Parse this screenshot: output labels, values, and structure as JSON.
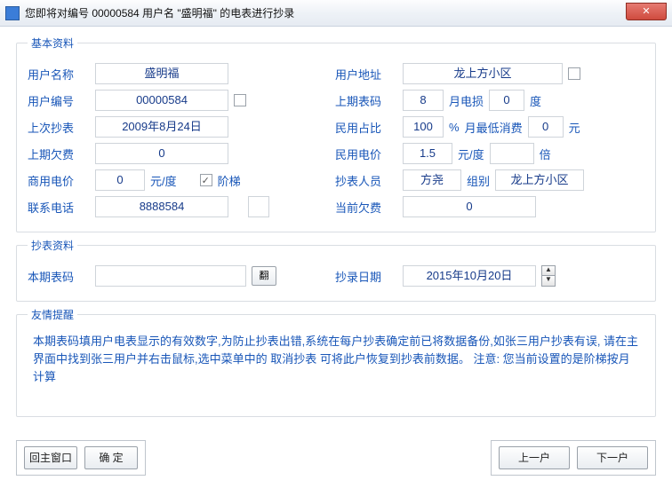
{
  "window": {
    "title": "您即将对编号 00000584 用户名 \"盛明福\" 的电表进行抄录",
    "close": "✕"
  },
  "groups": {
    "basic": "基本资料",
    "reading": "抄表资料",
    "reminder": "友情提醒"
  },
  "basic": {
    "userNameLabel": "用户名称",
    "userName": "盛明福",
    "userAddrLabel": "用户地址",
    "userAddr": "龙上方小区",
    "userNoLabel": "用户编号",
    "userNo": "00000584",
    "prevCodeLabel": "上期表码",
    "prevCode": "8",
    "monthLossLabel": "月电损",
    "monthLoss": "0",
    "unitDu": "度",
    "lastReadLabel": "上次抄表",
    "lastRead": "2009年8月24日",
    "resRatioLabel": "民用占比",
    "resRatio": "100",
    "pct": "%",
    "minConsLabel": "月最低消费",
    "minCons": "0",
    "unitYuan": "元",
    "prevOweLabel": "上期欠费",
    "prevOwe": "0",
    "resPriceLabel": "民用电价",
    "resPrice": "1.5",
    "yuanPerDu": "元/度",
    "timesLabel": "倍",
    "comPriceLabel": "商用电价",
    "comPrice": "0",
    "ladderLabel": "阶梯",
    "readerLabel": "抄表人员",
    "reader": "方尧",
    "groupLabel": "组别",
    "group": "龙上方小区",
    "phoneLabel": "联系电话",
    "phone": "8888584",
    "curOweLabel": "当前欠费",
    "curOwe": "0"
  },
  "reading": {
    "curCodeLabel": "本期表码",
    "curCode": "",
    "flipBtn": "翻",
    "readDateLabel": "抄录日期",
    "readDate": "2015年10月20日"
  },
  "reminder": {
    "text": "本期表码填用户电表显示的有效数字,为防止抄表出错,系统在每户抄表确定前已将数据备份,如张三用户抄表有误, 请在主界面中找到张三用户并右击鼠标,选中菜单中的 取消抄表 可将此户恢复到抄表前数据。   注意:    您当前设置的是阶梯按月计算"
  },
  "buttons": {
    "backMain": "回主窗口",
    "confirm": "确  定",
    "prev": "上一户",
    "next": "下一户"
  }
}
